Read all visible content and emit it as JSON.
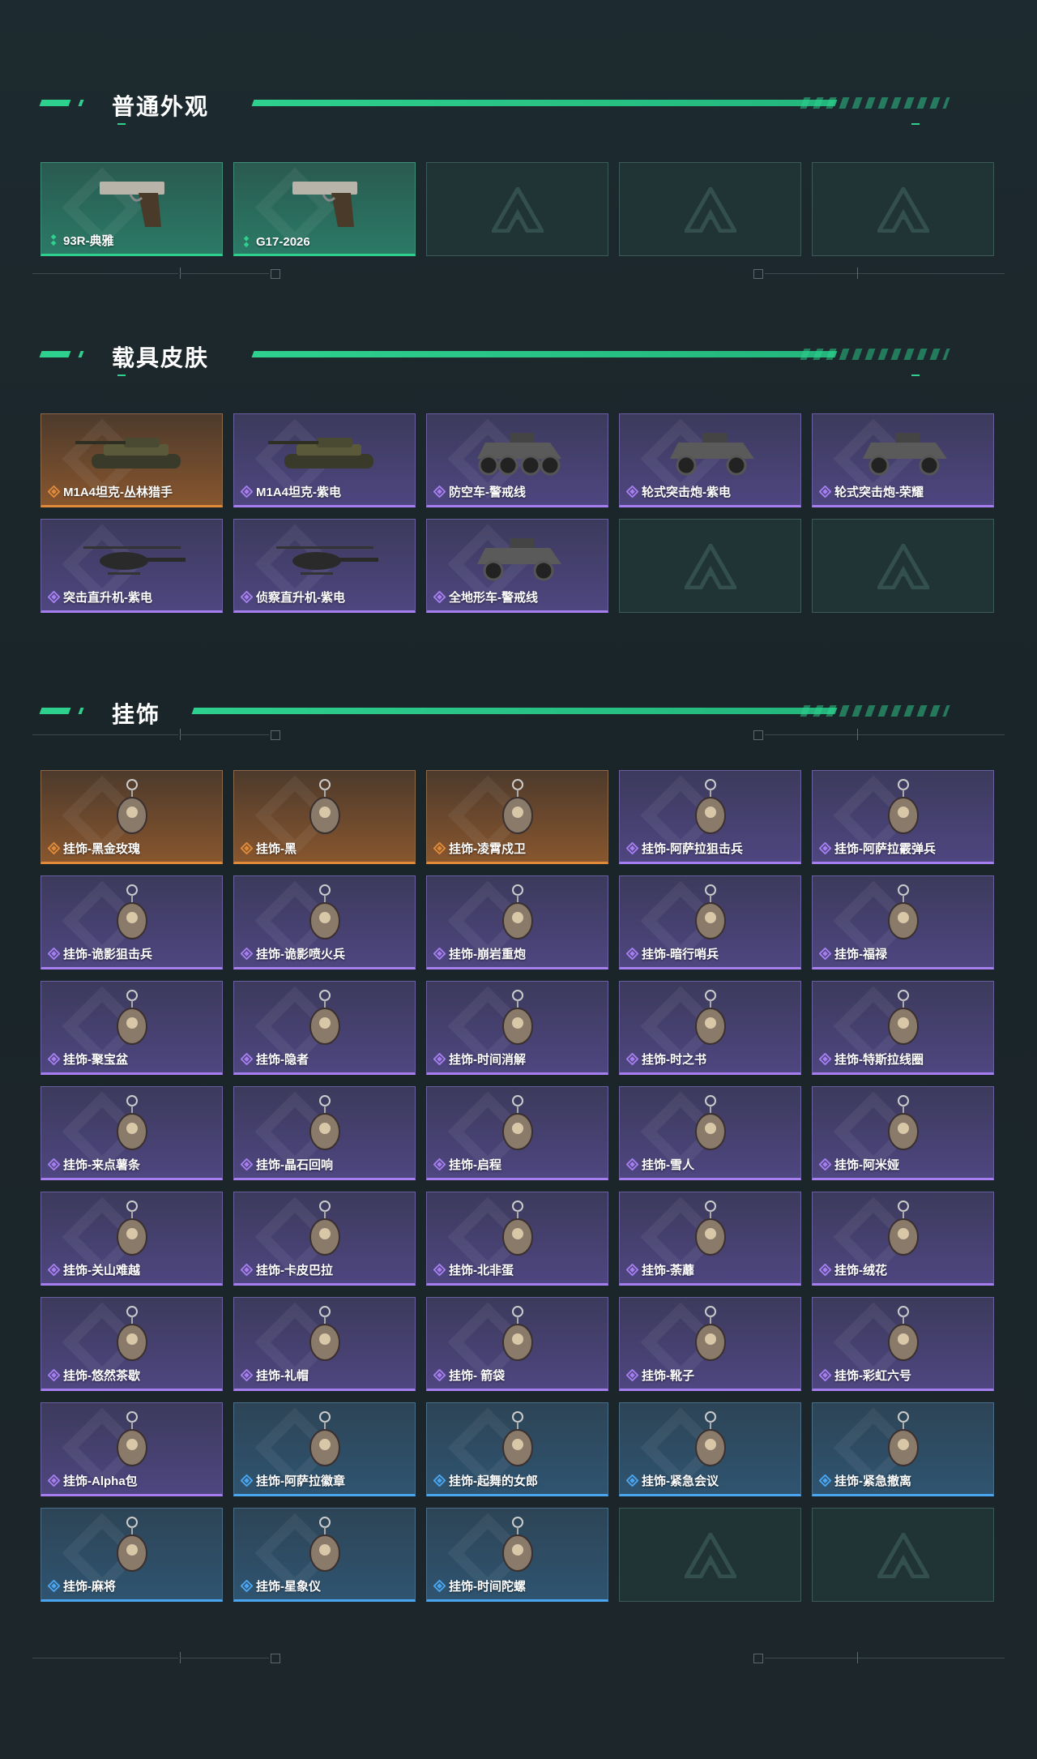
{
  "sections": {
    "weapon": {
      "title": "普通外观",
      "items": [
        {
          "label": "93R-典雅",
          "rarity": "green",
          "icon": "pistol-icon"
        },
        {
          "label": "G17-2026",
          "rarity": "green",
          "icon": "pistol-icon"
        },
        {
          "label": "",
          "rarity": "empty"
        },
        {
          "label": "",
          "rarity": "empty"
        },
        {
          "label": "",
          "rarity": "empty"
        }
      ]
    },
    "vehicle": {
      "title": "载具皮肤",
      "items": [
        {
          "label": "M1A4坦克-丛林猎手",
          "rarity": "gold",
          "icon": "tank-icon"
        },
        {
          "label": "M1A4坦克-紫电",
          "rarity": "purple",
          "icon": "tank-icon"
        },
        {
          "label": "防空车-警戒线",
          "rarity": "purple",
          "icon": "armored-vehicle-icon"
        },
        {
          "label": "轮式突击炮-紫电",
          "rarity": "purple",
          "icon": "armored-car-icon"
        },
        {
          "label": "轮式突击炮-荣耀",
          "rarity": "purple",
          "icon": "armored-car-icon"
        },
        {
          "label": "突击直升机-紫电",
          "rarity": "purple",
          "icon": "helicopter-icon"
        },
        {
          "label": "侦察直升机-紫电",
          "rarity": "purple",
          "icon": "helicopter-icon"
        },
        {
          "label": "全地形车-警戒线",
          "rarity": "purple",
          "icon": "atv-icon"
        },
        {
          "label": "",
          "rarity": "empty"
        },
        {
          "label": "",
          "rarity": "empty"
        }
      ]
    },
    "charm": {
      "title": "挂饰",
      "items": [
        {
          "label": "挂饰-黑金玫瑰",
          "rarity": "gold",
          "icon": "charm-icon"
        },
        {
          "label": "挂饰-黑",
          "rarity": "gold",
          "icon": "charm-icon"
        },
        {
          "label": "挂饰-凌霄戍卫",
          "rarity": "gold",
          "icon": "charm-icon"
        },
        {
          "label": "挂饰-阿萨拉狙击兵",
          "rarity": "purple",
          "icon": "charm-icon"
        },
        {
          "label": "挂饰-阿萨拉霰弹兵",
          "rarity": "purple",
          "icon": "charm-icon"
        },
        {
          "label": "挂饰-诡影狙击兵",
          "rarity": "purple",
          "icon": "charm-icon"
        },
        {
          "label": "挂饰-诡影喷火兵",
          "rarity": "purple",
          "icon": "charm-icon"
        },
        {
          "label": "挂饰-崩岩重炮",
          "rarity": "purple",
          "icon": "charm-icon"
        },
        {
          "label": "挂饰-暗行哨兵",
          "rarity": "purple",
          "icon": "charm-icon"
        },
        {
          "label": "挂饰-福禄",
          "rarity": "purple",
          "icon": "charm-icon"
        },
        {
          "label": "挂饰-聚宝盆",
          "rarity": "purple",
          "icon": "charm-icon"
        },
        {
          "label": "挂饰-隐者",
          "rarity": "purple",
          "icon": "charm-icon"
        },
        {
          "label": "挂饰-时间消解",
          "rarity": "purple",
          "icon": "charm-icon"
        },
        {
          "label": "挂饰-时之书",
          "rarity": "purple",
          "icon": "charm-icon"
        },
        {
          "label": "挂饰-特斯拉线圈",
          "rarity": "purple",
          "icon": "charm-icon"
        },
        {
          "label": "挂饰-来点薯条",
          "rarity": "purple",
          "icon": "charm-icon"
        },
        {
          "label": "挂饰-晶石回响",
          "rarity": "purple",
          "icon": "charm-icon"
        },
        {
          "label": "挂饰-启程",
          "rarity": "purple",
          "icon": "charm-icon"
        },
        {
          "label": "挂饰-雪人",
          "rarity": "purple",
          "icon": "charm-icon"
        },
        {
          "label": "挂饰-阿米娅",
          "rarity": "purple",
          "icon": "charm-icon"
        },
        {
          "label": "挂饰-关山难越",
          "rarity": "purple",
          "icon": "charm-icon"
        },
        {
          "label": "挂饰-卡皮巴拉",
          "rarity": "purple",
          "icon": "charm-icon"
        },
        {
          "label": "挂饰-北非蛋",
          "rarity": "purple",
          "icon": "charm-icon"
        },
        {
          "label": "挂饰-荼蘼",
          "rarity": "purple",
          "icon": "charm-icon"
        },
        {
          "label": "挂饰-绒花",
          "rarity": "purple",
          "icon": "charm-icon"
        },
        {
          "label": "挂饰-悠然茶歇",
          "rarity": "purple",
          "icon": "charm-icon"
        },
        {
          "label": "挂饰-礼帽",
          "rarity": "purple",
          "icon": "charm-icon"
        },
        {
          "label": "挂饰- 箭袋",
          "rarity": "purple",
          "icon": "charm-icon"
        },
        {
          "label": "挂饰-靴子",
          "rarity": "purple",
          "icon": "charm-icon"
        },
        {
          "label": "挂饰-彩虹六号",
          "rarity": "purple",
          "icon": "charm-icon"
        },
        {
          "label": "挂饰-Alpha包",
          "rarity": "purple",
          "icon": "charm-icon"
        },
        {
          "label": "挂饰-阿萨拉徽章",
          "rarity": "blue",
          "icon": "charm-icon"
        },
        {
          "label": "挂饰-起舞的女郎",
          "rarity": "blue",
          "icon": "charm-icon"
        },
        {
          "label": "挂饰-紧急会议",
          "rarity": "blue",
          "icon": "charm-icon"
        },
        {
          "label": "挂饰-紧急撤离",
          "rarity": "blue",
          "icon": "charm-icon"
        },
        {
          "label": "挂饰-麻将",
          "rarity": "blue",
          "icon": "charm-icon"
        },
        {
          "label": "挂饰-星象仪",
          "rarity": "blue",
          "icon": "charm-icon"
        },
        {
          "label": "挂饰-时间陀螺",
          "rarity": "blue",
          "icon": "charm-icon"
        },
        {
          "label": "",
          "rarity": "empty"
        },
        {
          "label": "",
          "rarity": "empty"
        }
      ]
    }
  },
  "colors": {
    "accent": "#2ed08e",
    "green": "#2ed08e",
    "gold": "#e08a3a",
    "purple": "#a67ef0",
    "blue": "#4aa6f0",
    "background": "#1c272b"
  }
}
